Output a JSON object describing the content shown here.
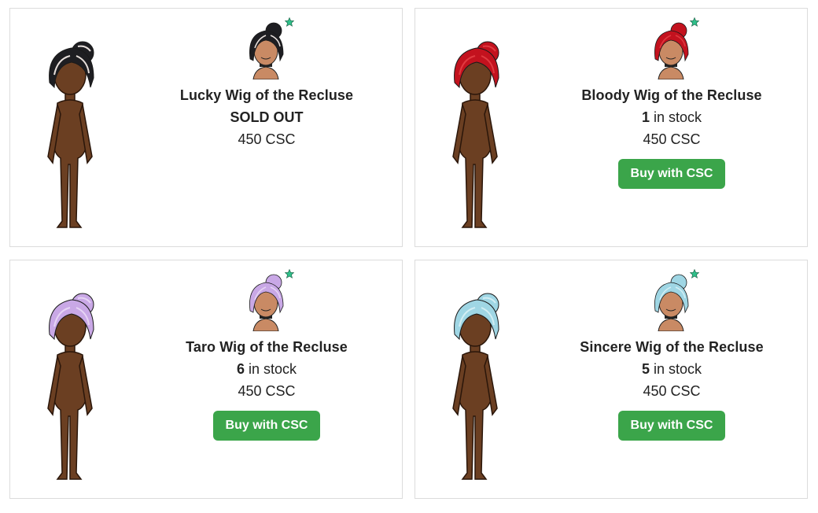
{
  "items": [
    {
      "name": "Lucky Wig of the Recluse",
      "stock_count": null,
      "stock_text": "SOLD OUT",
      "price": "450 CSC",
      "button": null,
      "hair_color": "#1e1e22",
      "hair_highlight": "#e8e0dc"
    },
    {
      "name": "Bloody Wig of the Recluse",
      "stock_count": "1",
      "stock_text": " in stock",
      "price": "450 CSC",
      "button": "Buy with CSC",
      "hair_color": "#c3121e",
      "hair_highlight": "#e03a40"
    },
    {
      "name": "Taro Wig of the Recluse",
      "stock_count": "6",
      "stock_text": " in stock",
      "price": "450 CSC",
      "button": "Buy with CSC",
      "hair_color": "#c9a8e6",
      "hair_highlight": "#e6d4f4"
    },
    {
      "name": "Sincere Wig of the Recluse",
      "stock_count": "5",
      "stock_text": " in stock",
      "price": "450 CSC",
      "button": "Buy with CSC",
      "hair_color": "#9fd6e4",
      "hair_highlight": "#d2eef4"
    }
  ],
  "colors": {
    "buy_button": "#3ba54a",
    "star": "#2fc08a",
    "skin": "#6b3f22"
  },
  "icons": {
    "badge": "star-icon"
  }
}
